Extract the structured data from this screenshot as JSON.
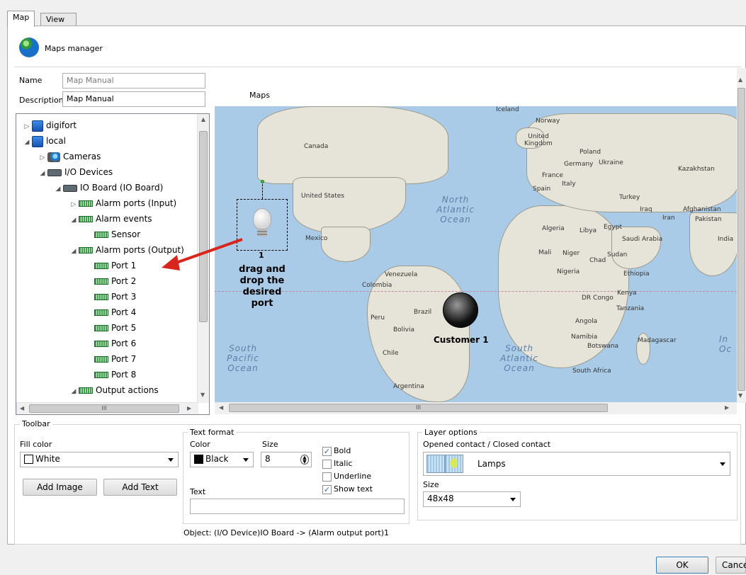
{
  "tabs": [
    "Map",
    "View Rights"
  ],
  "header": {
    "title": "Maps manager"
  },
  "form": {
    "name_label": "Name",
    "name_value": "Map Manual",
    "description_label": "Description",
    "description_value": "Map Manual"
  },
  "tree": {
    "nodes": [
      {
        "label": "digifort",
        "icon": "computer-icon"
      },
      {
        "label": "local",
        "icon": "computer-icon"
      },
      {
        "label": "Cameras",
        "icon": "camera-icon"
      },
      {
        "label": "I/O Devices",
        "icon": "io-device-icon"
      },
      {
        "label": "IO Board (IO Board)",
        "icon": "io-board-icon"
      },
      {
        "label": "Alarm ports (Input)",
        "icon": "board-icon"
      },
      {
        "label": "Alarm events",
        "icon": "board-icon"
      },
      {
        "label": "Sensor",
        "icon": "board-icon"
      },
      {
        "label": "Alarm ports (Output)",
        "icon": "board-icon"
      },
      {
        "label": "Port 1",
        "icon": "board-icon"
      },
      {
        "label": "Port 2",
        "icon": "board-icon"
      },
      {
        "label": "Port 3",
        "icon": "board-icon"
      },
      {
        "label": "Port 4",
        "icon": "board-icon"
      },
      {
        "label": "Port 5",
        "icon": "board-icon"
      },
      {
        "label": "Port 6",
        "icon": "board-icon"
      },
      {
        "label": "Port 7",
        "icon": "board-icon"
      },
      {
        "label": "Port 8",
        "icon": "board-icon"
      },
      {
        "label": "Output actions",
        "icon": "board-icon"
      }
    ],
    "scroll_mid": "III"
  },
  "map": {
    "title": "Maps",
    "scroll_mid": "III",
    "countries": [
      "Canada",
      "United States",
      "Mexico",
      "Venezuela",
      "Colombia",
      "Peru",
      "Brazil",
      "Bolivia",
      "Chile",
      "Argentina",
      "Norway",
      "United Kingdom",
      "Poland",
      "Germany",
      "Ukraine",
      "France",
      "Italy",
      "Spain",
      "Kazakhstan",
      "Turkey",
      "Iraq",
      "Iran",
      "Afghanistan",
      "Pakistan",
      "India",
      "Algeria",
      "Libya",
      "Egypt",
      "Saudi Arabia",
      "Mali",
      "Niger",
      "Chad",
      "Sudan",
      "Nigeria",
      "Ethiopia",
      "Kenya",
      "DR Congo",
      "Tanzania",
      "Angola",
      "Namibia",
      "Botswana",
      "Madagascar",
      "South Africa",
      "Iceland"
    ],
    "oceans": {
      "north_atlantic": [
        "North",
        "Atlantic",
        "Ocean"
      ],
      "south_pacific": [
        "South",
        "Pacific",
        "Ocean"
      ],
      "south_atlantic": [
        "South",
        "Atlantic",
        "Ocean"
      ],
      "indian": [
        "In",
        "Oc"
      ]
    },
    "lamp_label": "1",
    "instruction": [
      "drag and",
      "drop the",
      "desired",
      "port"
    ],
    "customer_label": "Customer 1"
  },
  "toolbar": {
    "group_label": "Toolbar",
    "fill_color_label": "Fill color",
    "fill_color_value": "White",
    "add_image": "Add Image",
    "add_text": "Add Text"
  },
  "text_format": {
    "group_label": "Text format",
    "color_label": "Color",
    "color_value": "Black",
    "size_label": "Size",
    "size_value": "8",
    "bold": "Bold",
    "italic": "Italic",
    "underline": "Underline",
    "show_text": "Show text",
    "text_label": "Text",
    "text_value": ""
  },
  "layer_options": {
    "group_label": "Layer options",
    "contact_label": "Opened contact / Closed contact",
    "contact_value": "Lamps",
    "size_label": "Size",
    "size_value": "48x48"
  },
  "object_status": "Object:  (I/O Device)IO Board -> (Alarm output port)1",
  "footer": {
    "ok": "OK",
    "cancel": "Cancel"
  },
  "colors": {
    "accent_arrow": "#d9261c",
    "map_water": "#aacbe8",
    "land": "#e6e4d8"
  }
}
